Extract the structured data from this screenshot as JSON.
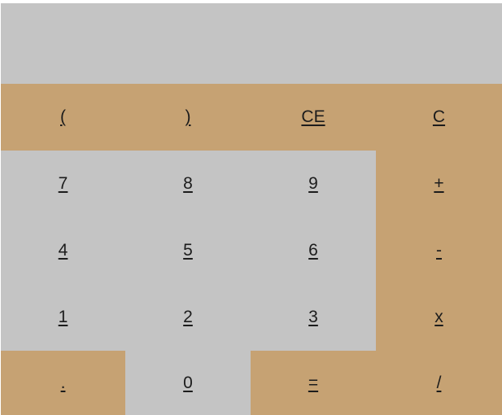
{
  "display": {
    "value": ""
  },
  "keys": {
    "open_paren": "(",
    "close_paren": ")",
    "clear_entry": "CE",
    "clear": "C",
    "seven": "7",
    "eight": "8",
    "nine": "9",
    "plus": "+",
    "four": "4",
    "five": "5",
    "six": "6",
    "minus": "-",
    "one": "1",
    "two": "2",
    "three": "3",
    "multiply": "x",
    "decimal": ".",
    "zero": "0",
    "equals": "=",
    "divide": "/"
  },
  "colors": {
    "display_bg": "#c4c4c4",
    "number_key_bg": "#c4c4c4",
    "operator_key_bg": "#c6a273"
  }
}
